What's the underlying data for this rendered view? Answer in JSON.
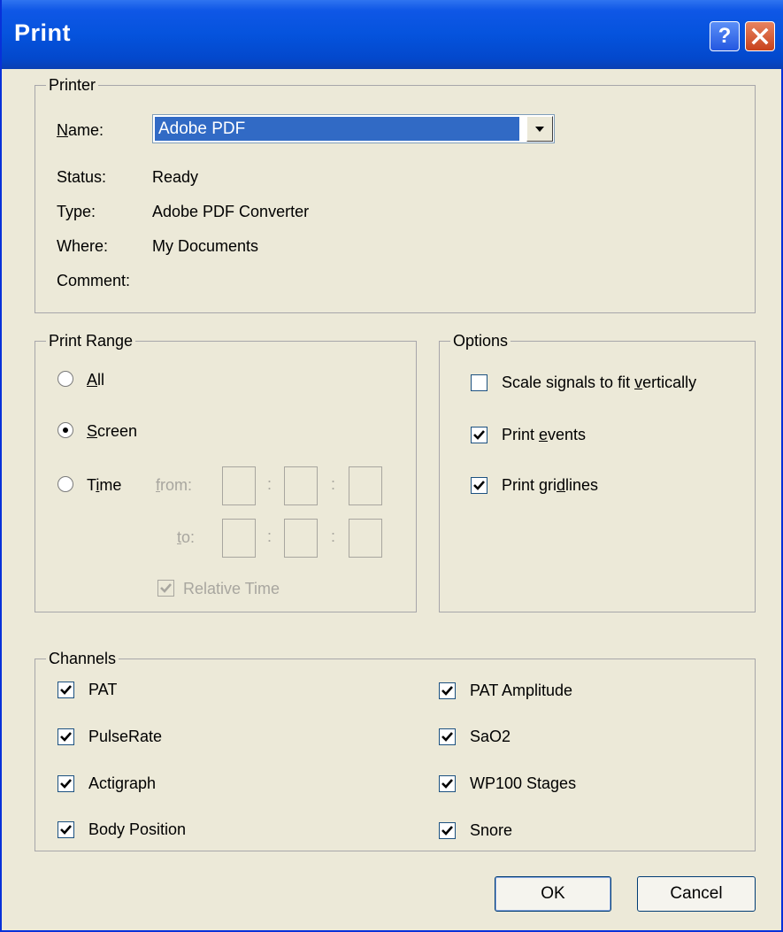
{
  "dialog": {
    "title": "Print",
    "help_label": "?"
  },
  "printer": {
    "legend": "Printer",
    "name_label_prefix": "",
    "name_label_accel": "N",
    "name_label_rest": "ame:",
    "name_value": "Adobe PDF",
    "status_label": "Status:",
    "status_value": "Ready",
    "type_label": "Type:",
    "type_value": "Adobe PDF Converter",
    "where_label": "Where:",
    "where_value": "My Documents",
    "comment_label": "Comment:",
    "comment_value": ""
  },
  "print_range": {
    "legend": "Print Range",
    "all": {
      "accel": "A",
      "rest": "ll",
      "checked": false
    },
    "screen": {
      "accel": "S",
      "rest": "creen",
      "checked": true
    },
    "time": {
      "prefix": "T",
      "accel": "i",
      "rest": "me",
      "checked": false
    },
    "from_accel": "f",
    "from_rest": "rom:",
    "to_accel": "t",
    "to_rest": "o:",
    "colon": ":",
    "relative_time": "Relative Time",
    "relative_time_checked": true
  },
  "options": {
    "legend": "Options",
    "scale": {
      "prefix": "Scale signals to fit ",
      "accel": "v",
      "rest": "ertically",
      "checked": false
    },
    "events": {
      "prefix": "Print ",
      "accel": "e",
      "rest": "vents",
      "checked": true
    },
    "gridlines": {
      "prefix": "Print gri",
      "accel": "d",
      "rest": "lines",
      "checked": true
    }
  },
  "channels": {
    "legend": "Channels",
    "left": [
      {
        "label": "PAT",
        "checked": true
      },
      {
        "label": "PulseRate",
        "checked": true
      },
      {
        "label": "Actigraph",
        "checked": true
      },
      {
        "label": "Body Position",
        "checked": true
      }
    ],
    "right": [
      {
        "label": "PAT Amplitude",
        "checked": true
      },
      {
        "label": "SaO2",
        "checked": true
      },
      {
        "label": "WP100 Stages",
        "checked": true
      },
      {
        "label": "Snore",
        "checked": true
      }
    ]
  },
  "buttons": {
    "ok": "OK",
    "cancel": "Cancel"
  }
}
